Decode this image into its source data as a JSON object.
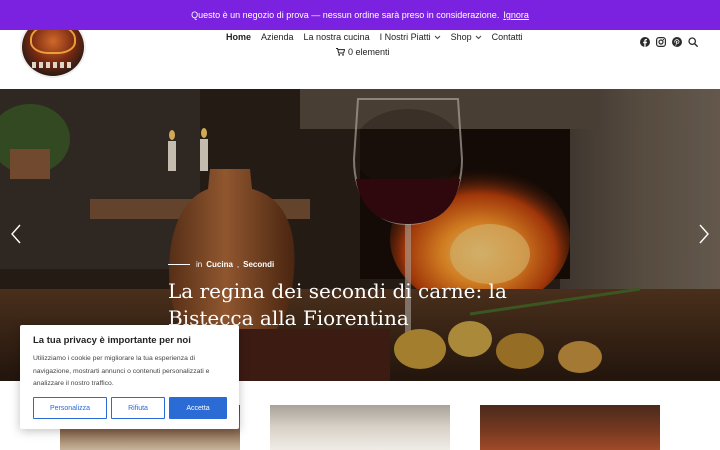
{
  "notice": {
    "text": "Questo è un negozio di prova — nessun ordine sarà preso in considerazione.",
    "dismiss": "Ignora"
  },
  "nav": {
    "items": [
      {
        "label": "Home",
        "active": true,
        "dropdown": false
      },
      {
        "label": "Azienda",
        "active": false,
        "dropdown": false
      },
      {
        "label": "La nostra cucina",
        "active": false,
        "dropdown": false
      },
      {
        "label": "I Nostri Piatti",
        "active": false,
        "dropdown": true
      },
      {
        "label": "Shop",
        "active": false,
        "dropdown": true
      },
      {
        "label": "Contatti",
        "active": false,
        "dropdown": false
      }
    ],
    "cart_label": "0 elementi"
  },
  "social": [
    "facebook-icon",
    "instagram-icon",
    "pinterest-icon",
    "search-icon"
  ],
  "hero": {
    "prefix": "in",
    "categories": [
      "Cucina",
      "Secondi"
    ],
    "title": "La regina dei secondi di carne: la Bistecca alla Fiorentina"
  },
  "cookie": {
    "title": "La tua privacy è importante per noi",
    "text": "Utilizziamo i cookie per migliorare la tua esperienza di navigazione, mostrarti annunci o contenuti personalizzati e analizzare il nostro traffico.",
    "customize": "Personalizza",
    "reject": "Rifiuta",
    "accept": "Accetta"
  },
  "colors": {
    "notice_bg": "#7b22e0",
    "button_blue": "#2b6bd6"
  }
}
